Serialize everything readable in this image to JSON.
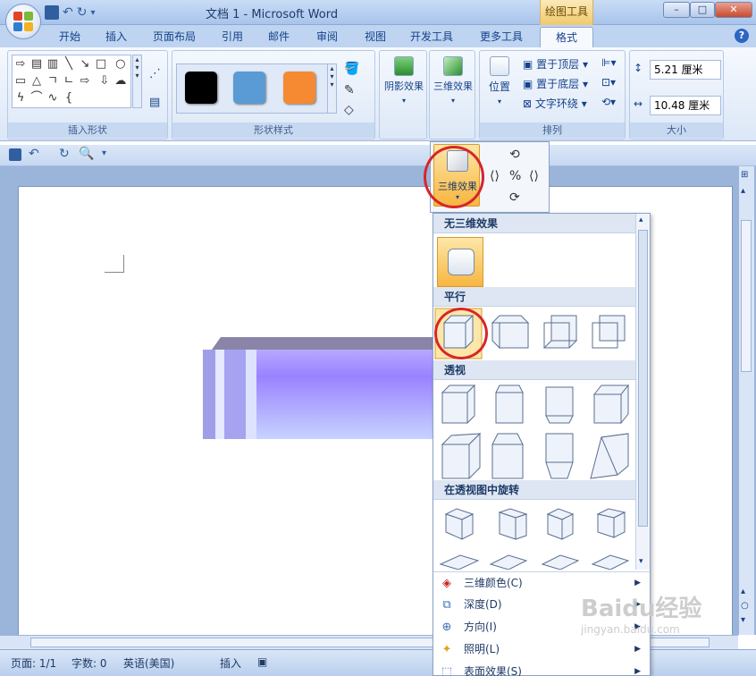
{
  "window": {
    "title": "文档 1 - Microsoft Word",
    "context_tab": "绘图工具",
    "controls": [
      "–",
      "□",
      "✕"
    ]
  },
  "ribbon_tabs": [
    "开始",
    "插入",
    "页面布局",
    "引用",
    "邮件",
    "审阅",
    "视图",
    "开发工具",
    "更多工具",
    "格式"
  ],
  "active_tab": "格式",
  "groups": {
    "insert_shapes": {
      "label": "插入形状"
    },
    "shape_styles": {
      "label": "形状样式",
      "swatches": [
        "#000000",
        "#5b9bd5",
        "#f58a33"
      ]
    },
    "shadow": {
      "label": "阴影效果"
    },
    "effects3d": {
      "label": "三维效果"
    },
    "arrange": {
      "label": "排列",
      "position": "位置",
      "bring_front": "置于顶层",
      "send_back": "置于底层",
      "text_wrap": "文字环绕"
    },
    "size": {
      "label": "大小",
      "height": "5.21 厘米",
      "width": "10.48 厘米"
    }
  },
  "popup": {
    "label": "三维效果"
  },
  "gallery": {
    "none_header": "无三维效果",
    "parallel_header": "平行",
    "perspective_header": "透视",
    "rotate_header": "在透视图中旋转",
    "menu": [
      {
        "label": "三维颜色(C)",
        "icon": "paint-bucket-icon"
      },
      {
        "label": "深度(D)",
        "icon": "depth-icon"
      },
      {
        "label": "方向(I)",
        "icon": "direction-icon"
      },
      {
        "label": "照明(L)",
        "icon": "lighting-icon"
      },
      {
        "label": "表面效果(S)",
        "icon": "surface-icon"
      }
    ]
  },
  "status": {
    "page": "页面: 1/1",
    "words": "字数: 0",
    "lang": "英语(美国)",
    "mode": "插入"
  },
  "watermark": {
    "brand": "Baidu经验",
    "url": "jingyan.baidu.com"
  },
  "colors": {
    "accent": "#d6262a",
    "shape_top": "#8a85a8",
    "shape_face": "#9a82ff"
  }
}
